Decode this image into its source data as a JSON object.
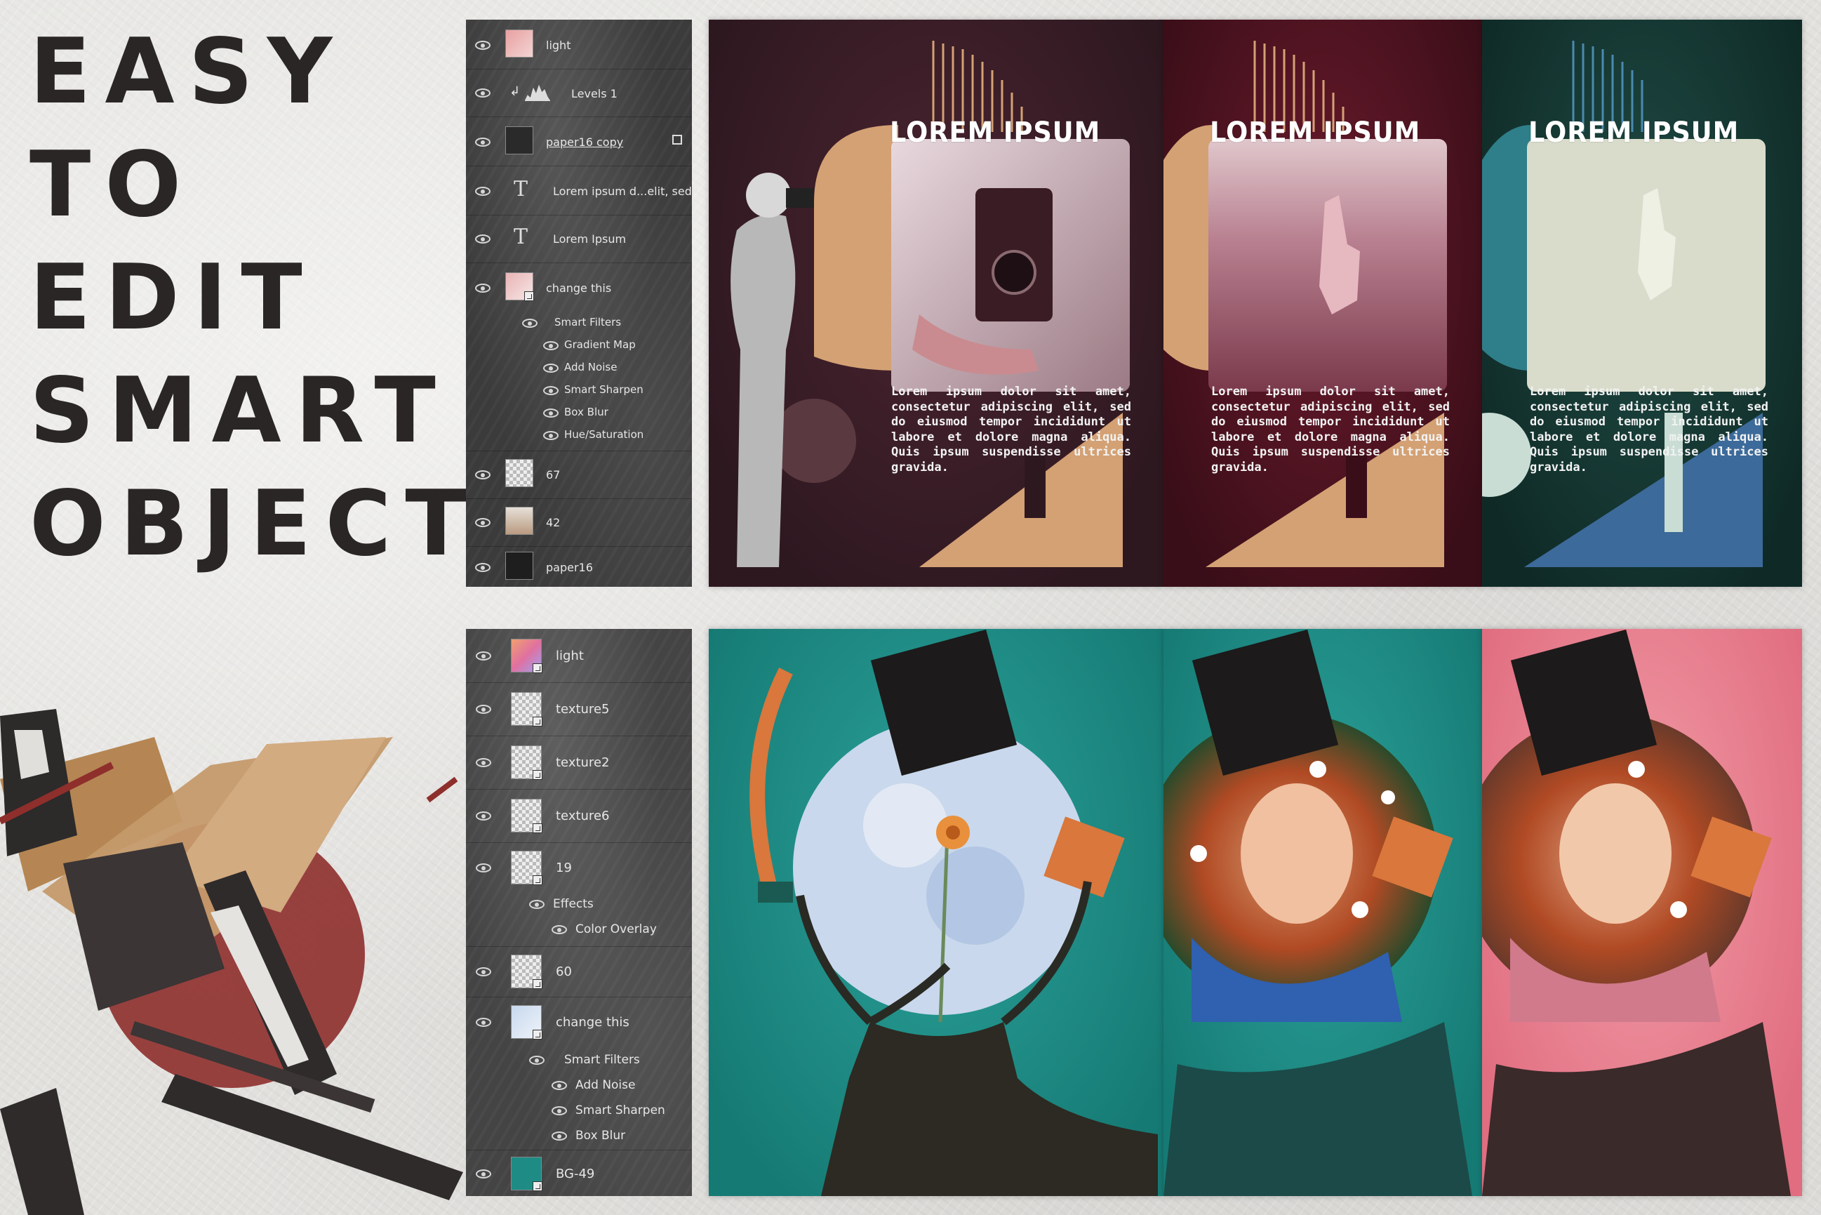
{
  "headline": [
    "EASY",
    "TO",
    "EDIT",
    "SMART",
    "OBJECTS"
  ],
  "colors": {
    "ink": "#2b2626",
    "panel": "#3b3b3b",
    "poster_burgundy": "#3a1a22",
    "poster_crimson": "#5a1524",
    "poster_teal_dark": "#163a36",
    "poster_teal": "#1e8c85",
    "poster_pink": "#e97c8c",
    "accent_tan": "#d4a174",
    "accent_orange": "#d9773c"
  },
  "layers_top": [
    {
      "label": "light",
      "icon": "thumbnail-icon"
    },
    {
      "label": "Levels 1",
      "icon": "levels-adjustment-icon"
    },
    {
      "label": "paper16 copy",
      "icon": "thumbnail-icon"
    },
    {
      "label": "Lorem ipsum d...elit, sed",
      "icon": "text-layer-icon"
    },
    {
      "label": "Lorem Ipsum",
      "icon": "text-layer-icon"
    },
    {
      "label": "change this",
      "icon": "smart-object-icon"
    },
    {
      "label": "Smart Filters",
      "icon": "eye-icon"
    },
    {
      "label": "Gradient Map",
      "icon": "eye-icon"
    },
    {
      "label": "Add Noise",
      "icon": "eye-icon"
    },
    {
      "label": "Smart Sharpen",
      "icon": "eye-icon"
    },
    {
      "label": "Box Blur",
      "icon": "eye-icon"
    },
    {
      "label": "Hue/Saturation",
      "icon": "eye-icon"
    },
    {
      "label": "67",
      "icon": "thumbnail-icon"
    },
    {
      "label": "42",
      "icon": "thumbnail-icon"
    },
    {
      "label": "paper16",
      "icon": "thumbnail-icon"
    }
  ],
  "layers_bottom": [
    {
      "label": "light",
      "icon": "smart-object-icon"
    },
    {
      "label": "texture5",
      "icon": "smart-object-icon"
    },
    {
      "label": "texture2",
      "icon": "smart-object-icon"
    },
    {
      "label": "texture6",
      "icon": "smart-object-icon"
    },
    {
      "label": "19",
      "icon": "smart-object-icon"
    },
    {
      "label": "Effects",
      "icon": "eye-icon"
    },
    {
      "label": "Color Overlay",
      "icon": "eye-icon"
    },
    {
      "label": "60",
      "icon": "smart-object-icon"
    },
    {
      "label": "change this",
      "icon": "smart-object-icon"
    },
    {
      "label": "Smart Filters",
      "icon": "eye-icon"
    },
    {
      "label": "Add Noise",
      "icon": "eye-icon"
    },
    {
      "label": "Smart Sharpen",
      "icon": "eye-icon"
    },
    {
      "label": "Box Blur",
      "icon": "eye-icon"
    },
    {
      "label": "BG-49",
      "icon": "smart-object-icon"
    }
  ],
  "posters_top": {
    "title": "LOREM IPSUM",
    "body": "Lorem ipsum dolor sit amet, consectetur adipiscing elit, sed do eiusmod tempor incididunt ut labore et dolore magna aliqua. Quis ipsum suspendisse ultrices gravida."
  }
}
